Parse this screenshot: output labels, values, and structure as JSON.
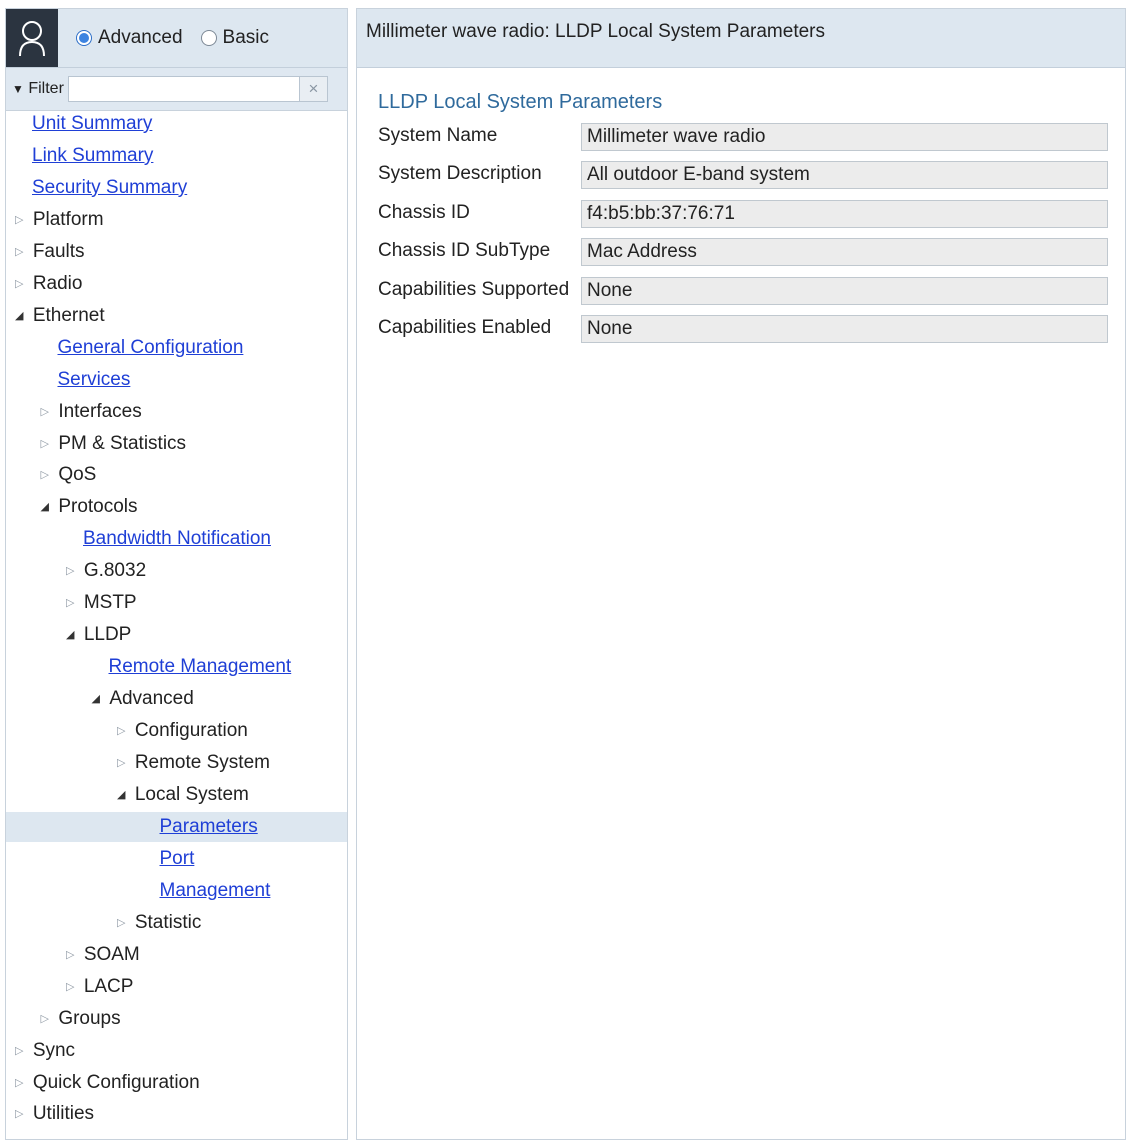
{
  "mode": {
    "options": [
      {
        "label": "Advanced",
        "selected": true
      },
      {
        "label": "Basic",
        "selected": false
      }
    ]
  },
  "filter": {
    "label": "Filter",
    "value": "",
    "placeholder": "",
    "clear_symbol": "×"
  },
  "tree": [
    {
      "label": "Unit Summary",
      "kind": "link",
      "level": 0,
      "arrow": "none"
    },
    {
      "label": "Link Summary",
      "kind": "link",
      "level": 0,
      "arrow": "none"
    },
    {
      "label": "Security Summary",
      "kind": "link",
      "level": 0,
      "arrow": "none"
    },
    {
      "label": "Platform",
      "kind": "node",
      "level": 0,
      "arrow": "collapsed"
    },
    {
      "label": "Faults",
      "kind": "node",
      "level": 0,
      "arrow": "collapsed"
    },
    {
      "label": "Radio",
      "kind": "node",
      "level": 0,
      "arrow": "collapsed"
    },
    {
      "label": "Ethernet",
      "kind": "node",
      "level": 0,
      "arrow": "expanded"
    },
    {
      "label": "General Configuration",
      "kind": "link",
      "level": 1,
      "arrow": "none"
    },
    {
      "label": "Services",
      "kind": "link",
      "level": 1,
      "arrow": "none"
    },
    {
      "label": "Interfaces",
      "kind": "node",
      "level": 1,
      "arrow": "collapsed"
    },
    {
      "label": "PM & Statistics",
      "kind": "node",
      "level": 1,
      "arrow": "collapsed"
    },
    {
      "label": "QoS",
      "kind": "node",
      "level": 1,
      "arrow": "collapsed"
    },
    {
      "label": "Protocols",
      "kind": "node",
      "level": 1,
      "arrow": "expanded"
    },
    {
      "label": "Bandwidth Notification",
      "kind": "link",
      "level": 2,
      "arrow": "none"
    },
    {
      "label": "G.8032",
      "kind": "node",
      "level": 2,
      "arrow": "collapsed"
    },
    {
      "label": "MSTP",
      "kind": "node",
      "level": 2,
      "arrow": "collapsed"
    },
    {
      "label": "LLDP",
      "kind": "node",
      "level": 2,
      "arrow": "expanded"
    },
    {
      "label": "Remote Management",
      "kind": "link",
      "level": 3,
      "arrow": "none"
    },
    {
      "label": "Advanced",
      "kind": "node",
      "level": 3,
      "arrow": "expanded"
    },
    {
      "label": "Configuration",
      "kind": "node",
      "level": 4,
      "arrow": "collapsed"
    },
    {
      "label": "Remote System",
      "kind": "node",
      "level": 4,
      "arrow": "collapsed"
    },
    {
      "label": "Local System",
      "kind": "node",
      "level": 4,
      "arrow": "expanded"
    },
    {
      "label": "Parameters",
      "kind": "link",
      "level": 5,
      "arrow": "none",
      "selected": true
    },
    {
      "label": "Port",
      "kind": "link",
      "level": 5,
      "arrow": "none"
    },
    {
      "label": "Management",
      "kind": "link",
      "level": 5,
      "arrow": "none"
    },
    {
      "label": "Statistic",
      "kind": "node",
      "level": 4,
      "arrow": "collapsed"
    },
    {
      "label": "SOAM",
      "kind": "node",
      "level": 2,
      "arrow": "collapsed"
    },
    {
      "label": "LACP",
      "kind": "node",
      "level": 2,
      "arrow": "collapsed"
    },
    {
      "label": "Groups",
      "kind": "node",
      "level": 1,
      "arrow": "collapsed"
    },
    {
      "label": "Sync",
      "kind": "node",
      "level": 0,
      "arrow": "collapsed"
    },
    {
      "label": "Quick Configuration",
      "kind": "node",
      "level": 0,
      "arrow": "collapsed"
    },
    {
      "label": "Utilities",
      "kind": "node",
      "level": 0,
      "arrow": "collapsed"
    }
  ],
  "main": {
    "header_title": "Millimeter wave radio: LLDP Local System Parameters",
    "section_title": "LLDP Local System Parameters",
    "params": [
      {
        "label": "System Name",
        "value": "Millimeter wave radio"
      },
      {
        "label": "System Description",
        "value": "All outdoor E-band system"
      },
      {
        "label": "Chassis ID",
        "value": "f4:b5:bb:37:76:71"
      },
      {
        "label": "Chassis ID SubType",
        "value": "Mac Address"
      },
      {
        "label": "Capabilities Supported",
        "value": "None"
      },
      {
        "label": "Capabilities Enabled",
        "value": "None"
      }
    ]
  },
  "icons": {
    "user": "user-icon",
    "collapsed_arrow": "triangle-right-icon",
    "expanded_arrow": "triangle-down-icon",
    "filter": "filter-triangle-icon",
    "clear": "close-icon"
  },
  "colors": {
    "link": "#1f3fd6",
    "section_title": "#2f6a9c",
    "header_bg": "#dde7f0",
    "selected_row": "#dde7f0"
  }
}
